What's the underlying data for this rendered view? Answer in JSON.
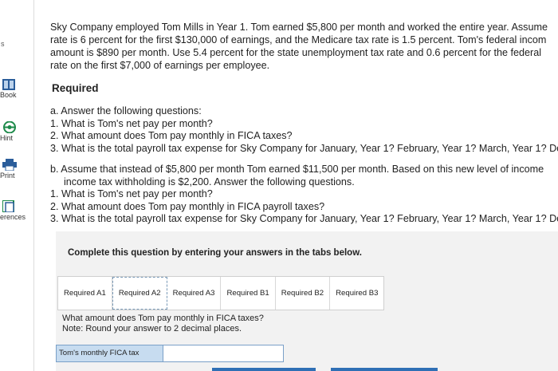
{
  "sidebar": {
    "items": [
      {
        "label": "Book",
        "icon": "book-icon"
      },
      {
        "label": "Hint",
        "icon": "hint-icon"
      },
      {
        "label": "Print",
        "icon": "print-icon"
      },
      {
        "label": "erences",
        "icon": "references-icon"
      }
    ],
    "top_fragment": "s"
  },
  "intro": {
    "line1": "Sky Company employed Tom Mills in Year 1. Tom earned $5,800 per month and worked the entire year. Assume",
    "line2": "rate is 6 percent for the first $130,000 of earnings, and the Medicare tax rate is 1.5 percent. Tom's federal incom",
    "line3": "amount is $890 per month. Use 5.4 percent for the state unemployment tax rate and 0.6 percent for the federal",
    "line4": "rate on the first $7,000 of earnings per employee."
  },
  "required_heading": "Required",
  "part_a": {
    "lead": "a. Answer the following questions:",
    "q1": "1. What is Tom's net pay per month?",
    "q2": "2. What amount does Tom pay monthly in FICA taxes?",
    "q3": "3. What is the total payroll tax expense for Sky Company for January, Year 1? February, Year 1? March, Year 1? De"
  },
  "part_b": {
    "lead1": "b. Assume that instead of $5,800 per month Tom earned $11,500 per month. Based on this new level of income",
    "lead2": "income tax withholding is $2,200. Answer the following questions.",
    "q1": "1. What is Tom's net pay per month?",
    "q2": "2. What amount does Tom pay monthly in FICA payroll taxes?",
    "q3": "3. What is the total payroll tax expense for Sky Company for January, Year 1? February, Year 1? March, Year 1? De"
  },
  "panel": {
    "title": "Complete this question by entering your answers in the tabs below.",
    "tabs": [
      "Required A1",
      "Required A2",
      "Required A3",
      "Required B1",
      "Required B2",
      "Required B3"
    ],
    "active_tab": "Required A2",
    "question": "What amount does Tom pay monthly in FICA taxes?",
    "note": "Note: Round your answer to 2 decimal places.",
    "answer_label": "Tom's monthly FICA tax",
    "answer_value": ""
  },
  "colors": {
    "accent": "#2f6fb5",
    "answer_label_bg": "#c7dcf0",
    "panel_bg": "#f2f2f2"
  }
}
